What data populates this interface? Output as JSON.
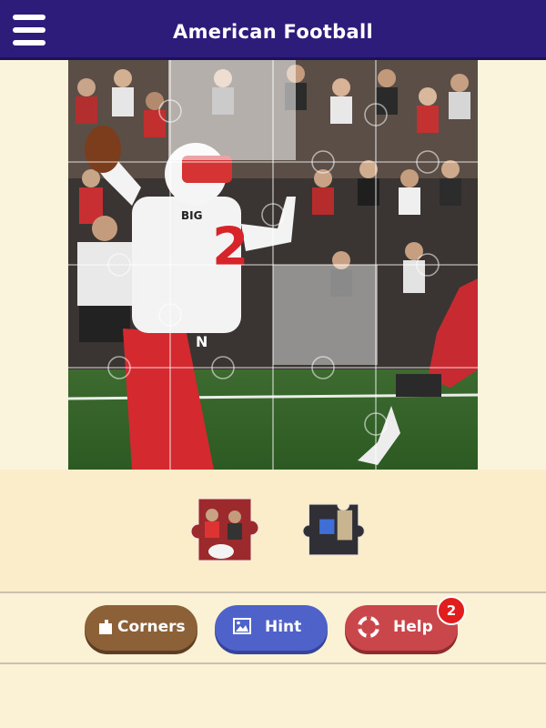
{
  "header": {
    "title": "American Football"
  },
  "toolbar": {
    "corners_label": "Corners",
    "hint_label": "Hint",
    "help_label": "Help",
    "help_badge": "2"
  },
  "board": {
    "jersey_number": "2",
    "jersey_letter": "N",
    "sleeve_logo": "BIG"
  },
  "tray": {
    "pieces": [
      "red-crowd-piece",
      "dark-player-piece"
    ]
  },
  "colors": {
    "header_bg": "#2e1c7a",
    "corners_button": "#8d6137",
    "hint_button": "#4f62c9",
    "help_button": "#c9474b",
    "badge": "#e11d1d"
  }
}
